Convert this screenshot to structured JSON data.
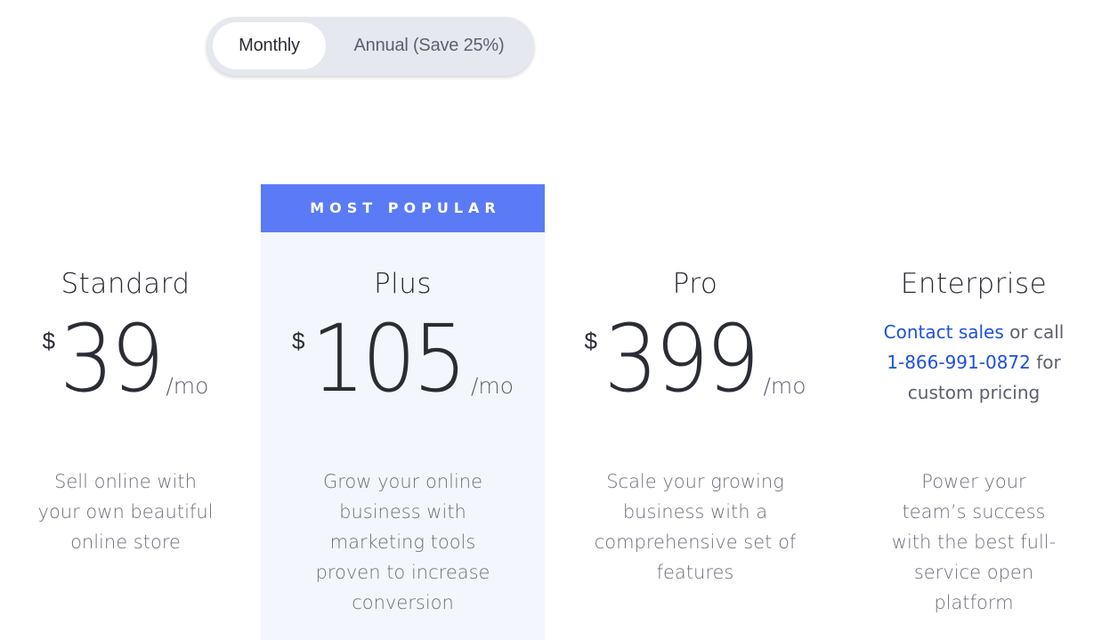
{
  "billing_toggle": {
    "options": [
      {
        "label": "Monthly",
        "selected": true
      },
      {
        "label": "Annual (Save 25%)",
        "selected": false
      }
    ]
  },
  "banner": {
    "label": "MOST POPULAR"
  },
  "colors": {
    "accent": "#5b7bf6",
    "highlight_bg": "#f3f6fd",
    "link": "#1e50e0",
    "text_dark": "#2b2d36",
    "text_muted": "#6e707c",
    "toggle_bg": "#e6e8ef"
  },
  "plans": [
    {
      "name": "Standard",
      "currency": "$",
      "price": "39",
      "period": "/mo",
      "description_lines": [
        "Sell online with",
        "your own beautiful",
        "online store"
      ]
    },
    {
      "name": "Plus",
      "currency": "$",
      "price": "105",
      "period": "/mo",
      "most_popular": true,
      "description_lines": [
        "Grow your online",
        "business with",
        "marketing tools",
        "proven to increase",
        "conversion"
      ]
    },
    {
      "name": "Pro",
      "currency": "$",
      "price": "399",
      "period": "/mo",
      "description_lines": [
        "Scale your growing",
        "business with a",
        "comprehensive set of",
        "features"
      ]
    },
    {
      "name": "Enterprise",
      "contact": {
        "link_label": "Contact sales",
        "text_after_link": " or call",
        "phone": "1-866-991-0872",
        "text_after_phone": " for",
        "last_line": "custom pricing"
      },
      "description_lines": [
        "Power your",
        "team’s success",
        "with the best full-",
        "service open",
        "platform"
      ]
    }
  ]
}
